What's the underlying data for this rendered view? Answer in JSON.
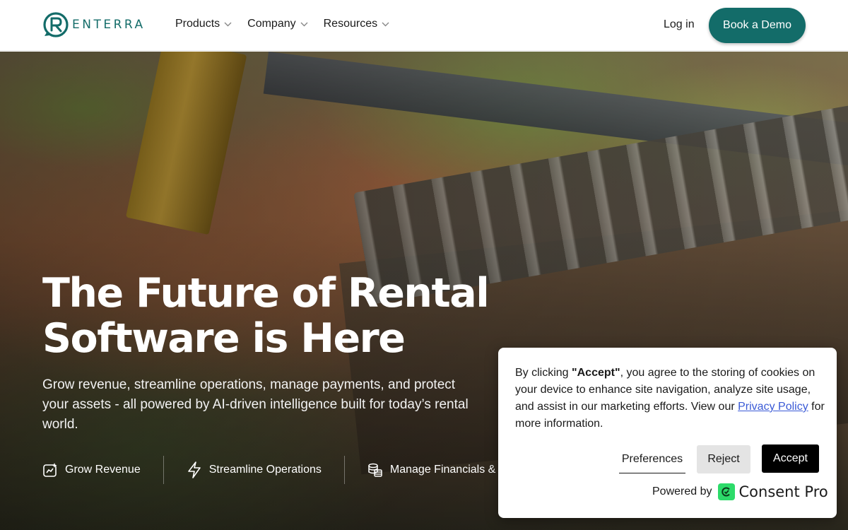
{
  "brand": {
    "name": "ENTERRA",
    "color": "#136c69"
  },
  "nav": {
    "menu": [
      {
        "label": "Products"
      },
      {
        "label": "Company"
      },
      {
        "label": "Resources"
      }
    ],
    "login_label": "Log in",
    "demo_label": "Book a Demo"
  },
  "hero": {
    "title": "The Future of Rental Software is Here",
    "subtitle": "Grow revenue, streamline operations, manage payments, and protect your assets - all powered by AI-driven intelligence built for today’s rental world.",
    "features": [
      {
        "icon": "chart-sparkle-icon",
        "label": "Grow Revenue"
      },
      {
        "icon": "lightning-icon",
        "label": "Streamline Operations"
      },
      {
        "icon": "coins-icon",
        "label": "Manage Financials & P"
      }
    ]
  },
  "cookie": {
    "text_before": "By clicking ",
    "text_bold": "\"Accept\"",
    "text_after": ", you agree to the storing of cookies on your device to enhance site navigation, analyze site usage, and assist in our marketing efforts. View our ",
    "link_label": "Privacy Policy",
    "text_end": " for more information.",
    "preferences_label": "Preferences",
    "reject_label": "Reject",
    "accept_label": "Accept",
    "powered_label": "Powered by",
    "powered_brand": "Consent Pro",
    "powered_color": "#2ddb6a"
  }
}
